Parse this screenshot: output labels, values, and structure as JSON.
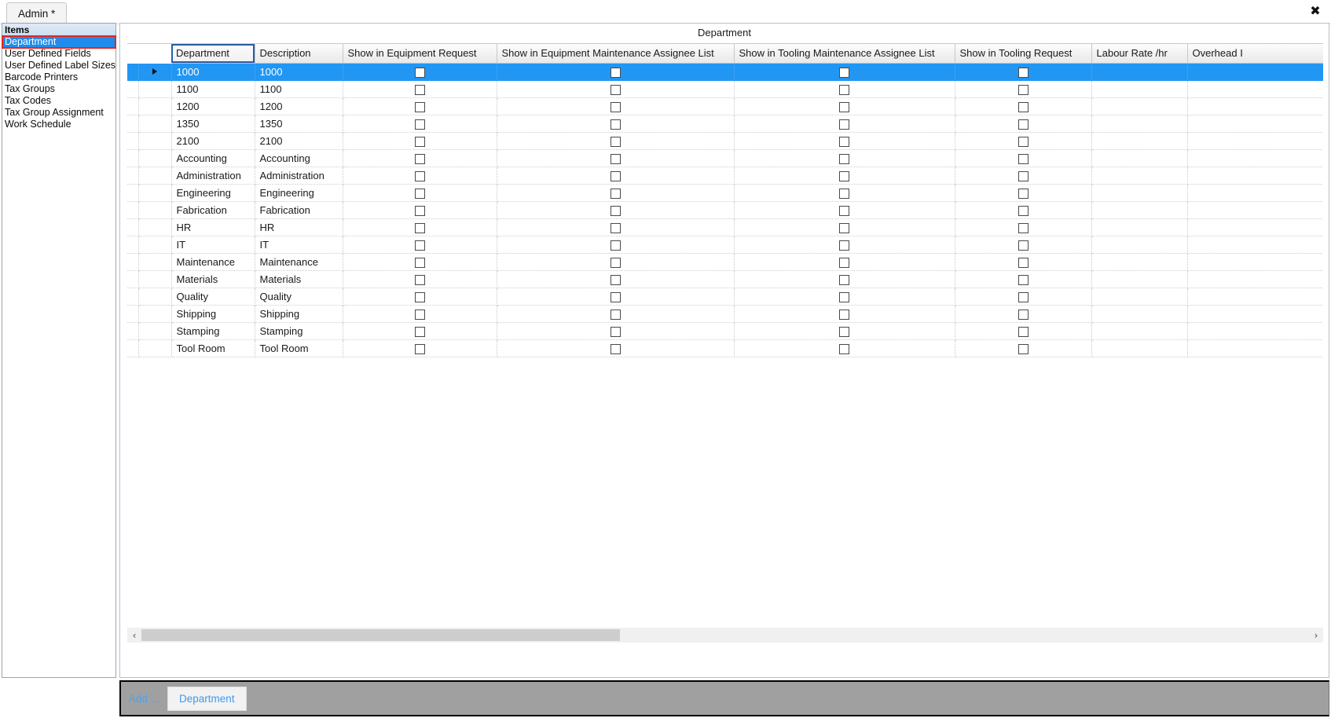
{
  "window": {
    "close_label": "✖",
    "tabs": [
      {
        "label": "Admin *"
      }
    ]
  },
  "sidebar": {
    "header": "Items",
    "items": [
      {
        "label": "Department",
        "selected": true
      },
      {
        "label": "User Defined Fields",
        "selected": false
      },
      {
        "label": "User Defined Label Sizes",
        "selected": false
      },
      {
        "label": "Barcode Printers",
        "selected": false
      },
      {
        "label": "Tax Groups",
        "selected": false
      },
      {
        "label": "Tax Codes",
        "selected": false
      },
      {
        "label": "Tax Group Assignment",
        "selected": false
      },
      {
        "label": "Work Schedule",
        "selected": false
      }
    ]
  },
  "content": {
    "title": "Department"
  },
  "grid": {
    "columns": [
      {
        "key": "department",
        "label": "Department",
        "focused": true
      },
      {
        "key": "description",
        "label": "Description",
        "focused": false
      },
      {
        "key": "show_in_equipment_request",
        "label": "Show in Equipment Request",
        "focused": false
      },
      {
        "key": "show_in_equipment_maintenance_assignee_list",
        "label": "Show in Equipment Maintenance Assignee List",
        "focused": false
      },
      {
        "key": "show_in_tooling_maintenance_assignee_list",
        "label": "Show in Tooling Maintenance Assignee List",
        "focused": false
      },
      {
        "key": "show_in_tooling_request",
        "label": "Show in Tooling Request",
        "focused": false
      },
      {
        "key": "labour_rate",
        "label": "Labour Rate /hr",
        "focused": false
      },
      {
        "key": "overhead",
        "label": "Overhead I",
        "focused": false
      }
    ],
    "rows": [
      {
        "department": "1000",
        "description": "1000",
        "show_in_equipment_request": false,
        "show_in_equipment_maintenance_assignee_list": false,
        "show_in_tooling_maintenance_assignee_list": false,
        "show_in_tooling_request": false,
        "labour_rate": "",
        "overhead": "",
        "selected": true,
        "current": true
      },
      {
        "department": "1100",
        "description": "1100",
        "show_in_equipment_request": false,
        "show_in_equipment_maintenance_assignee_list": false,
        "show_in_tooling_maintenance_assignee_list": false,
        "show_in_tooling_request": false,
        "labour_rate": "",
        "overhead": "",
        "selected": false,
        "current": false
      },
      {
        "department": "1200",
        "description": "1200",
        "show_in_equipment_request": false,
        "show_in_equipment_maintenance_assignee_list": false,
        "show_in_tooling_maintenance_assignee_list": false,
        "show_in_tooling_request": false,
        "labour_rate": "",
        "overhead": "",
        "selected": false,
        "current": false
      },
      {
        "department": "1350",
        "description": "1350",
        "show_in_equipment_request": false,
        "show_in_equipment_maintenance_assignee_list": false,
        "show_in_tooling_maintenance_assignee_list": false,
        "show_in_tooling_request": false,
        "labour_rate": "",
        "overhead": "",
        "selected": false,
        "current": false
      },
      {
        "department": "2100",
        "description": "2100",
        "show_in_equipment_request": false,
        "show_in_equipment_maintenance_assignee_list": false,
        "show_in_tooling_maintenance_assignee_list": false,
        "show_in_tooling_request": false,
        "labour_rate": "",
        "overhead": "",
        "selected": false,
        "current": false
      },
      {
        "department": "Accounting",
        "description": "Accounting",
        "show_in_equipment_request": false,
        "show_in_equipment_maintenance_assignee_list": false,
        "show_in_tooling_maintenance_assignee_list": false,
        "show_in_tooling_request": false,
        "labour_rate": "",
        "overhead": "",
        "selected": false,
        "current": false
      },
      {
        "department": "Administration",
        "description": "Administration",
        "show_in_equipment_request": false,
        "show_in_equipment_maintenance_assignee_list": false,
        "show_in_tooling_maintenance_assignee_list": false,
        "show_in_tooling_request": false,
        "labour_rate": "",
        "overhead": "",
        "selected": false,
        "current": false
      },
      {
        "department": "Engineering",
        "description": "Engineering",
        "show_in_equipment_request": false,
        "show_in_equipment_maintenance_assignee_list": false,
        "show_in_tooling_maintenance_assignee_list": false,
        "show_in_tooling_request": false,
        "labour_rate": "",
        "overhead": "",
        "selected": false,
        "current": false
      },
      {
        "department": "Fabrication",
        "description": "Fabrication",
        "show_in_equipment_request": false,
        "show_in_equipment_maintenance_assignee_list": false,
        "show_in_tooling_maintenance_assignee_list": false,
        "show_in_tooling_request": false,
        "labour_rate": "",
        "overhead": "",
        "selected": false,
        "current": false
      },
      {
        "department": "HR",
        "description": "HR",
        "show_in_equipment_request": false,
        "show_in_equipment_maintenance_assignee_list": false,
        "show_in_tooling_maintenance_assignee_list": false,
        "show_in_tooling_request": false,
        "labour_rate": "",
        "overhead": "",
        "selected": false,
        "current": false
      },
      {
        "department": "IT",
        "description": "IT",
        "show_in_equipment_request": false,
        "show_in_equipment_maintenance_assignee_list": false,
        "show_in_tooling_maintenance_assignee_list": false,
        "show_in_tooling_request": false,
        "labour_rate": "",
        "overhead": "",
        "selected": false,
        "current": false
      },
      {
        "department": "Maintenance",
        "description": "Maintenance",
        "show_in_equipment_request": false,
        "show_in_equipment_maintenance_assignee_list": false,
        "show_in_tooling_maintenance_assignee_list": false,
        "show_in_tooling_request": false,
        "labour_rate": "",
        "overhead": "",
        "selected": false,
        "current": false
      },
      {
        "department": "Materials",
        "description": "Materials",
        "show_in_equipment_request": false,
        "show_in_equipment_maintenance_assignee_list": false,
        "show_in_tooling_maintenance_assignee_list": false,
        "show_in_tooling_request": false,
        "labour_rate": "",
        "overhead": "",
        "selected": false,
        "current": false
      },
      {
        "department": "Quality",
        "description": "Quality",
        "show_in_equipment_request": false,
        "show_in_equipment_maintenance_assignee_list": false,
        "show_in_tooling_maintenance_assignee_list": false,
        "show_in_tooling_request": false,
        "labour_rate": "",
        "overhead": "",
        "selected": false,
        "current": false
      },
      {
        "department": "Shipping",
        "description": "Shipping",
        "show_in_equipment_request": false,
        "show_in_equipment_maintenance_assignee_list": false,
        "show_in_tooling_maintenance_assignee_list": false,
        "show_in_tooling_request": false,
        "labour_rate": "",
        "overhead": "",
        "selected": false,
        "current": false
      },
      {
        "department": "Stamping",
        "description": "Stamping",
        "show_in_equipment_request": false,
        "show_in_equipment_maintenance_assignee_list": false,
        "show_in_tooling_maintenance_assignee_list": false,
        "show_in_tooling_request": false,
        "labour_rate": "",
        "overhead": "",
        "selected": false,
        "current": false
      },
      {
        "department": "Tool Room",
        "description": "Tool Room",
        "show_in_equipment_request": false,
        "show_in_equipment_maintenance_assignee_list": false,
        "show_in_tooling_maintenance_assignee_list": false,
        "show_in_tooling_request": false,
        "labour_rate": "",
        "overhead": "",
        "selected": false,
        "current": false
      }
    ]
  },
  "scrollbar": {
    "left_arrow": "‹",
    "right_arrow": "›",
    "thumb_fraction_start": 0.0,
    "thumb_fraction_end": 0.41
  },
  "action_bar": {
    "add_label": "Add ...",
    "department_button": "Department"
  },
  "colors": {
    "selection_blue": "#2196f3",
    "highlight_red": "#e8241d",
    "link_blue": "#4aa3f0",
    "action_bar_gray": "#a0a0a0",
    "header_gradient_top": "#fdfdfd"
  }
}
